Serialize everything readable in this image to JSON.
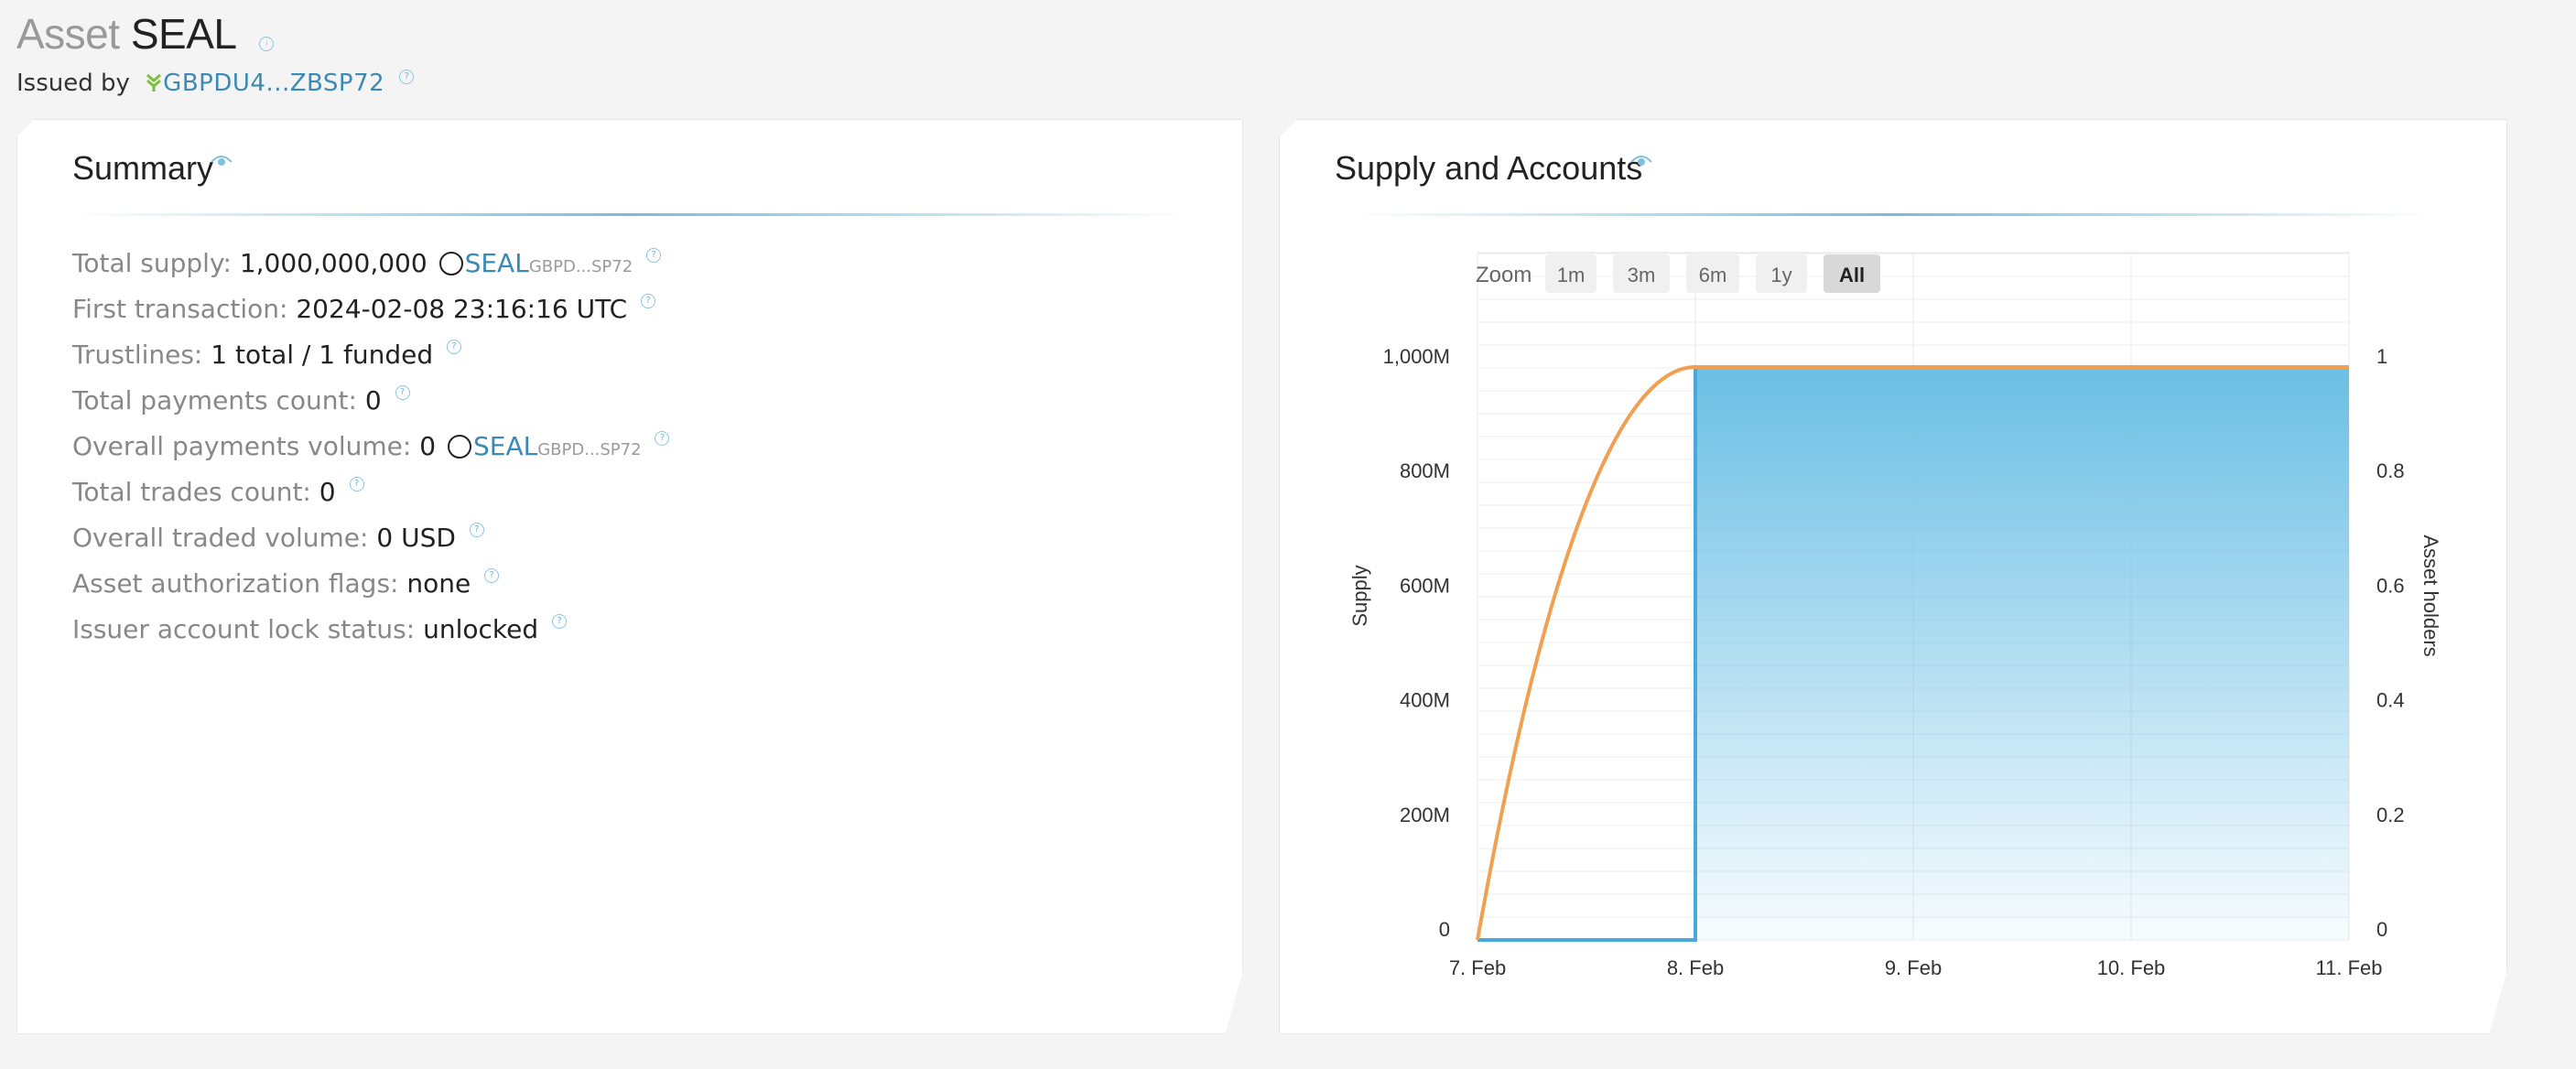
{
  "header": {
    "title_prefix": "Asset",
    "asset_code": "SEAL",
    "issued_by_label": "Issued by",
    "issuer_short": "GBPDU4...ZBSP72",
    "help_glyph": "?"
  },
  "summary": {
    "title": "Summary",
    "rows": [
      {
        "label": "Total supply:",
        "value": "1,000,000,000",
        "asset_code": "SEAL",
        "asset_issuer": "GBPD...SP72"
      },
      {
        "label": "First transaction:",
        "value": "2024-02-08 23:16:16 UTC"
      },
      {
        "label": "Trustlines:",
        "value": "1 total / 1 funded"
      },
      {
        "label": "Total payments count:",
        "value": "0"
      },
      {
        "label": "Overall payments volume:",
        "value": "0",
        "asset_code": "SEAL",
        "asset_issuer": "GBPD...SP72"
      },
      {
        "label": "Total trades count:",
        "value": "0"
      },
      {
        "label": "Overall traded volume:",
        "value": "0 USD"
      },
      {
        "label": "Asset authorization flags:",
        "value": "none"
      },
      {
        "label": "Issuer account lock status:",
        "value": "unlocked"
      }
    ]
  },
  "supply_panel": {
    "title": "Supply and Accounts",
    "zoom_label": "Zoom",
    "zoom_options": [
      "1m",
      "3m",
      "6m",
      "1y",
      "All"
    ],
    "zoom_selected": "All"
  },
  "colors": {
    "accent_link": "#3a8ab5",
    "supply_line": "#f0a050",
    "holders_line": "#4aa8dc",
    "holders_fill": "#6bbfe5"
  },
  "chart_data": {
    "type": "area",
    "x_categories": [
      "7. Feb",
      "8. Feb",
      "9. Feb",
      "10. Feb",
      "11. Feb"
    ],
    "y_left": {
      "label": "Supply",
      "ticks": [
        "0",
        "200M",
        "400M",
        "600M",
        "800M",
        "1,000M"
      ],
      "range": [
        0,
        1000000000
      ]
    },
    "y_right": {
      "label": "Asset holders",
      "ticks": [
        "0",
        "0.2",
        "0.4",
        "0.6",
        "0.8",
        "1"
      ],
      "range": [
        0,
        1
      ]
    },
    "series": [
      {
        "type": "line",
        "points": [
          [
            "7. Feb",
            0
          ],
          [
            "8. Feb",
            1000000000
          ],
          [
            "11. Feb",
            1000000000
          ]
        ]
      },
      {
        "type": "area-step",
        "points": [
          [
            "7. Feb",
            0
          ],
          [
            "8. Feb",
            0
          ],
          [
            "8. Feb",
            1
          ],
          [
            "11. Feb",
            1
          ]
        ]
      }
    ]
  }
}
